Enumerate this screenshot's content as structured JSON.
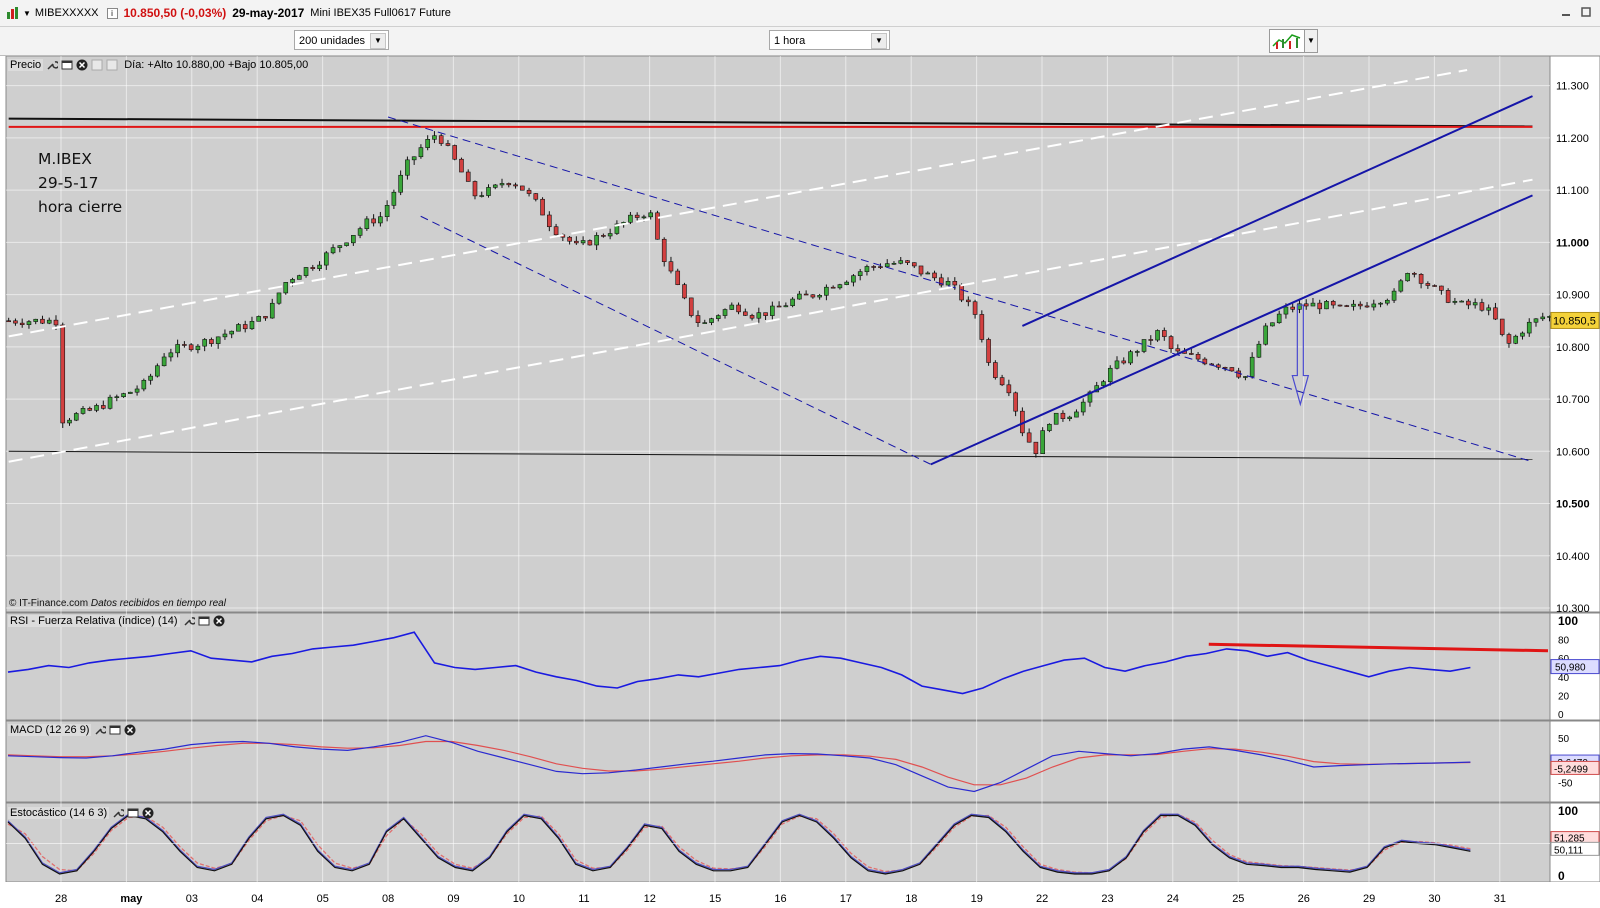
{
  "window": {
    "symbol": "MIBEXXXXX",
    "info_icon": "i",
    "last_price": "10.850,50 (-0,03%)",
    "date": "29-may-2017",
    "contract": "Mini IBEX35 Full0617 Future"
  },
  "toolbar": {
    "units_select": "200 unidades",
    "interval_select": "1 hora"
  },
  "price_panel": {
    "label": "Precio",
    "day_info": "Día: +Alto 10.880,00 +Bajo 10.805,00",
    "annotation": [
      "M.IBEX",
      "29-5-17",
      "hora cierre"
    ],
    "source": "© IT-Finance.com",
    "source_note": "Datos recibidos en tiempo real",
    "last_value_label": "10.850,5"
  },
  "rsi_panel": {
    "label": "RSI - Fuerza Relativa (índice) (14)",
    "value_label": "50,980"
  },
  "macd_panel": {
    "label": "MACD (12 26 9)",
    "value_label_1": "-3,6470",
    "value_label_2": "-5,2499"
  },
  "stoch_panel": {
    "label": "Estocástico (14 6 3)",
    "value_label_1": "51,285",
    "value_label_2": "50,111"
  },
  "colors": {
    "background": "#cfcfcf",
    "candle_up": "#3aa63a",
    "candle_down": "#d24040",
    "channel_blue": "#1515a8",
    "resistance_red": "#e01515",
    "rsi_line": "#1a1ae0",
    "macd_line": "#2a2ad0",
    "signal_line": "#e05050"
  },
  "chart_data": [
    {
      "type": "candlestick",
      "title": "Precio",
      "x": [
        "28",
        "may",
        "03",
        "04",
        "05",
        "08",
        "09",
        "10",
        "11",
        "12",
        "15",
        "16",
        "17",
        "18",
        "19",
        "22",
        "23",
        "24",
        "25",
        "26",
        "29",
        "30",
        "31"
      ],
      "y_ticks": [
        "11.300",
        "11.200",
        "11.100",
        "11.000",
        "10.900",
        "10.800",
        "10.700",
        "10.600",
        "10.500",
        "10.400",
        "10.300"
      ],
      "ylim": [
        10300,
        11330
      ],
      "close_path": [
        [
          0,
          10660
        ],
        [
          0.5,
          10680
        ],
        [
          0.8,
          10700
        ],
        [
          1.0,
          10710
        ],
        [
          1.3,
          10730
        ],
        [
          1.6,
          10790
        ],
        [
          1.9,
          10800
        ],
        [
          2.2,
          10810
        ],
        [
          2.4,
          10820
        ],
        [
          2.6,
          10830
        ],
        [
          3.0,
          10850
        ],
        [
          3.2,
          10870
        ],
        [
          3.4,
          10920
        ],
        [
          3.6,
          10940
        ],
        [
          3.9,
          10960
        ],
        [
          4.2,
          10990
        ],
        [
          4.5,
          11020
        ],
        [
          4.7,
          11040
        ],
        [
          4.9,
          11050
        ],
        [
          5.1,
          11100
        ],
        [
          5.3,
          11150
        ],
        [
          5.5,
          11180
        ],
        [
          5.75,
          11210
        ],
        [
          5.9,
          11180
        ],
        [
          6.1,
          11140
        ],
        [
          6.3,
          11090
        ],
        [
          6.6,
          11100
        ],
        [
          6.8,
          11120
        ],
        [
          7.0,
          11110
        ],
        [
          7.3,
          11070
        ],
        [
          7.5,
          11030
        ],
        [
          7.7,
          11010
        ],
        [
          7.9,
          10990
        ],
        [
          8.2,
          11010
        ],
        [
          8.5,
          11030
        ],
        [
          8.8,
          11050
        ],
        [
          9.0,
          11060
        ],
        [
          9.15,
          10990
        ],
        [
          9.4,
          10920
        ],
        [
          9.6,
          10870
        ],
        [
          9.8,
          10840
        ],
        [
          10.0,
          10860
        ],
        [
          10.3,
          10880
        ],
        [
          10.6,
          10860
        ],
        [
          10.9,
          10870
        ],
        [
          11.2,
          10890
        ],
        [
          11.5,
          10900
        ],
        [
          11.8,
          10920
        ],
        [
          12.0,
          10930
        ],
        [
          12.3,
          10950
        ],
        [
          12.6,
          10960
        ],
        [
          12.9,
          10960
        ],
        [
          13.2,
          10940
        ],
        [
          13.4,
          10930
        ],
        [
          13.6,
          10920
        ],
        [
          13.8,
          10890
        ],
        [
          14.0,
          10860
        ],
        [
          14.2,
          10760
        ],
        [
          14.5,
          10720
        ],
        [
          14.7,
          10640
        ],
        [
          14.9,
          10600
        ],
        [
          15.1,
          10660
        ],
        [
          15.4,
          10670
        ],
        [
          15.7,
          10700
        ],
        [
          16.0,
          10750
        ],
        [
          16.3,
          10780
        ],
        [
          16.6,
          10810
        ],
        [
          16.8,
          10830
        ],
        [
          17.0,
          10790
        ],
        [
          17.3,
          10780
        ],
        [
          17.6,
          10770
        ],
        [
          17.9,
          10760
        ],
        [
          18.1,
          10740
        ],
        [
          18.4,
          10830
        ],
        [
          18.7,
          10870
        ],
        [
          19.0,
          10880
        ],
        [
          19.3,
          10880
        ],
        [
          19.6,
          10870
        ],
        [
          19.9,
          10880
        ],
        [
          20.1,
          10890
        ],
        [
          20.4,
          10900
        ],
        [
          20.6,
          10950
        ],
        [
          20.9,
          10920
        ],
        [
          21.1,
          10900
        ],
        [
          21.4,
          10880
        ],
        [
          21.7,
          10880
        ],
        [
          21.9,
          10860
        ],
        [
          22.1,
          10800
        ],
        [
          22.4,
          10840
        ],
        [
          22.7,
          10860
        ],
        [
          22.9,
          10850
        ],
        [
          23.2,
          10855
        ],
        [
          23.5,
          10845
        ],
        [
          23.8,
          10845
        ],
        [
          24.0,
          10850
        ]
      ],
      "lines": [
        {
          "name": "black-resistance",
          "from": [
            -0.8,
            11237
          ],
          "to": [
            22.5,
            11222
          ]
        },
        {
          "name": "red-resistance",
          "from": [
            -0.8,
            11221
          ],
          "to": [
            22.5,
            11221
          ]
        },
        {
          "name": "black-support",
          "from": [
            -0.8,
            10600
          ],
          "to": [
            22.5,
            10585
          ]
        },
        {
          "name": "downtrend-upper",
          "from": [
            5.0,
            11240
          ],
          "to": [
            22.5,
            10580
          ]
        },
        {
          "name": "downtrend-lower",
          "from": [
            5.5,
            11050
          ],
          "to": [
            13.3,
            10575
          ]
        },
        {
          "name": "white-dashed-1",
          "from": [
            -0.8,
            10820
          ],
          "to": [
            21.5,
            11330
          ]
        },
        {
          "name": "white-dashed-2",
          "from": [
            -0.8,
            10580
          ],
          "to": [
            22.5,
            11120
          ]
        },
        {
          "name": "up-channel-lower",
          "from": [
            13.3,
            10575
          ],
          "to": [
            22.5,
            11090
          ]
        },
        {
          "name": "up-channel-upper",
          "from": [
            14.7,
            10840
          ],
          "to": [
            22.5,
            11280
          ]
        }
      ]
    },
    {
      "type": "line",
      "title": "RSI - Fuerza Relativa (índice) (14)",
      "y_ticks": [
        "100",
        "80",
        "60",
        "40",
        "20",
        "0"
      ],
      "ylim": [
        0,
        100
      ],
      "values": [
        45,
        48,
        52,
        50,
        55,
        58,
        60,
        62,
        65,
        68,
        60,
        58,
        56,
        62,
        65,
        70,
        72,
        74,
        78,
        82,
        88,
        55,
        50,
        48,
        50,
        52,
        45,
        40,
        36,
        30,
        28,
        35,
        38,
        42,
        40,
        44,
        48,
        50,
        52,
        58,
        62,
        60,
        55,
        50,
        42,
        30,
        26,
        22,
        28,
        38,
        46,
        52,
        58,
        60,
        50,
        46,
        52,
        56,
        62,
        65,
        70,
        68,
        62,
        66,
        58,
        52,
        46,
        40,
        46,
        50,
        48,
        46,
        50
      ]
    },
    {
      "type": "line",
      "title": "MACD (12 26 9)",
      "y_ticks": [
        "50",
        "0",
        "-50"
      ],
      "series": [
        {
          "name": "MACD",
          "values": [
            10,
            8,
            6,
            5,
            10,
            18,
            25,
            35,
            40,
            42,
            38,
            30,
            25,
            22,
            30,
            40,
            55,
            40,
            20,
            5,
            -10,
            -25,
            -30,
            -28,
            -22,
            -15,
            -8,
            -2,
            5,
            12,
            15,
            14,
            10,
            5,
            -10,
            -35,
            -60,
            -70,
            -50,
            -20,
            10,
            20,
            15,
            10,
            15,
            25,
            30,
            22,
            12,
            0,
            -15,
            -12,
            -10,
            -8,
            -7,
            -6,
            -4
          ]
        },
        {
          "name": "Signal",
          "values": [
            12,
            10,
            8,
            8,
            10,
            14,
            20,
            27,
            33,
            38,
            38,
            35,
            30,
            27,
            28,
            33,
            42,
            42,
            33,
            22,
            8,
            -8,
            -18,
            -24,
            -24,
            -20,
            -14,
            -8,
            -2,
            5,
            10,
            12,
            12,
            9,
            2,
            -15,
            -38,
            -55,
            -55,
            -40,
            -15,
            5,
            12,
            12,
            13,
            20,
            26,
            25,
            18,
            9,
            -3,
            -8,
            -9,
            -8,
            -7,
            -6,
            -5
          ]
        }
      ]
    },
    {
      "type": "line",
      "title": "Estocástico (14 6 3)",
      "y_ticks": [
        "100",
        "50",
        "0"
      ],
      "ylim": [
        0,
        100
      ],
      "series": [
        {
          "name": "%K",
          "values": [
            85,
            60,
            20,
            5,
            10,
            40,
            75,
            95,
            90,
            70,
            40,
            15,
            10,
            20,
            60,
            90,
            95,
            80,
            40,
            15,
            10,
            20,
            70,
            90,
            60,
            30,
            15,
            10,
            30,
            70,
            95,
            90,
            60,
            20,
            10,
            15,
            45,
            80,
            75,
            40,
            20,
            10,
            10,
            15,
            50,
            85,
            95,
            85,
            60,
            30,
            10,
            5,
            10,
            20,
            50,
            80,
            95,
            92,
            70,
            40,
            15,
            8,
            5,
            5,
            10,
            30,
            70,
            95,
            95,
            80,
            50,
            30,
            20,
            18,
            15,
            15,
            12,
            10,
            8,
            15,
            45,
            55,
            52,
            50,
            45,
            40
          ]
        },
        {
          "name": "%D",
          "values": [
            80,
            65,
            30,
            10,
            8,
            35,
            70,
            90,
            92,
            75,
            45,
            20,
            12,
            18,
            55,
            85,
            93,
            85,
            48,
            20,
            12,
            18,
            62,
            88,
            65,
            35,
            18,
            12,
            28,
            65,
            90,
            92,
            65,
            25,
            12,
            13,
            40,
            75,
            77,
            45,
            24,
            12,
            11,
            14,
            45,
            80,
            92,
            88,
            65,
            35,
            14,
            7,
            9,
            18,
            45,
            75,
            92,
            93,
            75,
            45,
            18,
            10,
            6,
            5,
            9,
            27,
            65,
            90,
            95,
            83,
            55,
            33,
            22,
            19,
            16,
            15,
            13,
            11,
            9,
            13,
            40,
            52,
            53,
            51,
            47,
            42
          ]
        }
      ]
    }
  ]
}
